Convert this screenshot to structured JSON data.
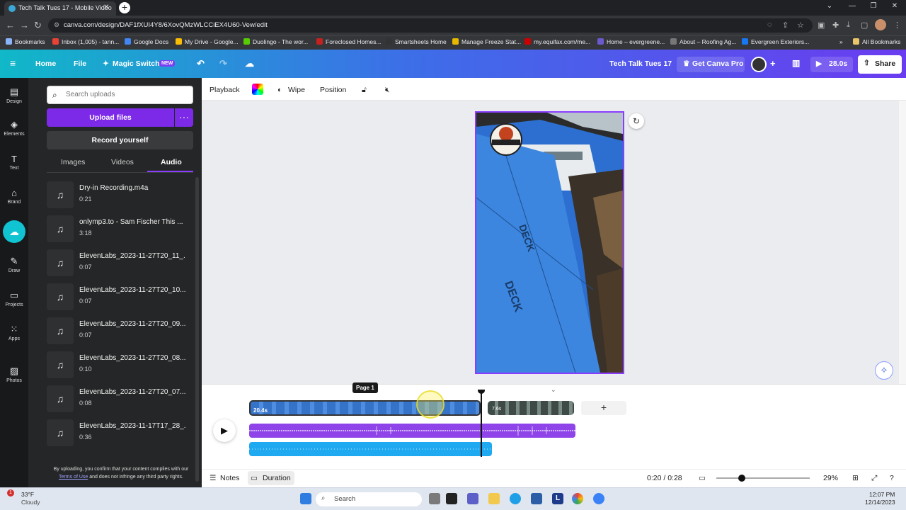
{
  "browser": {
    "tab_title": "Tech Talk Tues 17 - Mobile Video",
    "url": "canva.com/design/DAF1fXUI4Y8/6XovQMzWLCCiEX4U60-Vew/edit",
    "bookmarks": [
      "Bookmarks",
      "Inbox (1,005) - tann...",
      "Google Docs",
      "My Drive - Google...",
      "Duolingo - The wor...",
      "Foreclosed Homes...",
      "Smartsheets Home",
      "Manage Freeze Stat...",
      "my.equifax.com/me...",
      "Home – evergreene...",
      "About – Roofing Ag...",
      "Evergreen Exteriors..."
    ],
    "all_bookmarks": "All Bookmarks"
  },
  "header": {
    "home": "Home",
    "file": "File",
    "magic_switch": "Magic Switch",
    "new_badge": "NEW",
    "design_title": "Tech Talk Tues 17",
    "get_pro": "Get Canva Pro",
    "duration": "28.0s",
    "share": "Share"
  },
  "rail": [
    {
      "label": "Design",
      "icon": "design-icon"
    },
    {
      "label": "Elements",
      "icon": "elements-icon"
    },
    {
      "label": "Text",
      "icon": "text-icon"
    },
    {
      "label": "Brand",
      "icon": "brand-icon"
    },
    {
      "label": "",
      "icon": "uploads-icon"
    },
    {
      "label": "Draw",
      "icon": "draw-icon"
    },
    {
      "label": "Projects",
      "icon": "projects-icon"
    },
    {
      "label": "Apps",
      "icon": "apps-icon"
    },
    {
      "label": "Photos",
      "icon": "photos-icon"
    }
  ],
  "panel": {
    "search_placeholder": "Search uploads",
    "upload_files": "Upload files",
    "record_yourself": "Record yourself",
    "tabs": [
      "Images",
      "Videos",
      "Audio"
    ],
    "active_tab": "Audio",
    "items": [
      {
        "name": "Dry-in Recording.m4a",
        "duration": "0:21"
      },
      {
        "name": "onlymp3.to - Sam Fischer This ...",
        "duration": "3:18"
      },
      {
        "name": "ElevenLabs_2023-11-27T20_11_...",
        "duration": "0:07"
      },
      {
        "name": "ElevenLabs_2023-11-27T20_10...",
        "duration": "0:07"
      },
      {
        "name": "ElevenLabs_2023-11-27T20_09...",
        "duration": "0:07"
      },
      {
        "name": "ElevenLabs_2023-11-27T20_08...",
        "duration": "0:10"
      },
      {
        "name": "ElevenLabs_2023-11-27T20_07...",
        "duration": "0:08"
      },
      {
        "name": "ElevenLabs_2023-11-17T17_28_...",
        "duration": "0:36"
      }
    ],
    "disclaimer_pre": "By uploading, you confirm that your content complies with our",
    "disclaimer_link": "Terms of Use",
    "disclaimer_post": "and does not infringe any third party rights."
  },
  "toolbar": {
    "playback": "Playback",
    "wipe": "Wipe",
    "position": "Position"
  },
  "timeline": {
    "page_label": "Page 1",
    "clip1_duration": "20.4s",
    "clip2_duration": "7.6s"
  },
  "bottom": {
    "notes": "Notes",
    "duration_btn": "Duration",
    "time": "0:20 / 0:28",
    "zoom": "29%",
    "zoom_level": 0.29
  },
  "taskbar": {
    "weather_temp": "33°F",
    "weather_desc": "Cloudy",
    "weather_badge": "1",
    "search": "Search",
    "time": "12:07 PM",
    "date": "12/14/2023"
  },
  "colors": {
    "canva_purple": "#7d2ae8",
    "selection": "#8b3dff",
    "audio_purple": "#8e44e8",
    "audio_blue": "#1fa9f0"
  }
}
